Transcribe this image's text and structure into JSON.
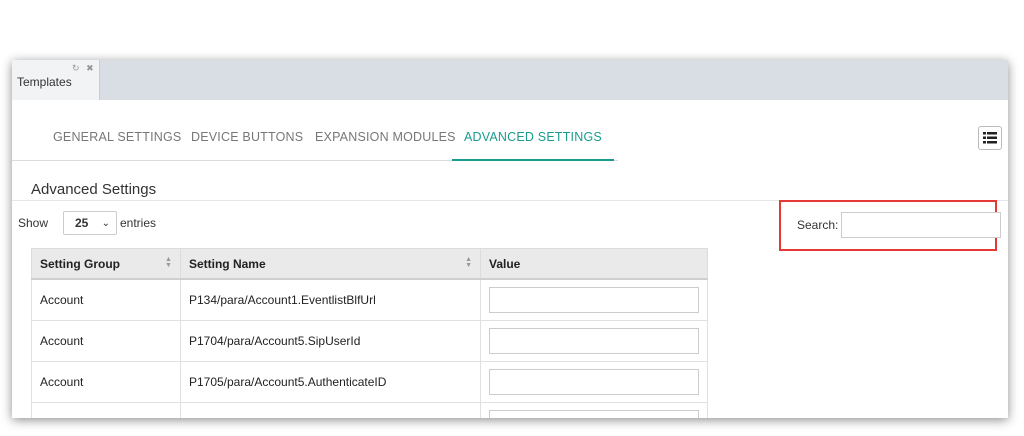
{
  "window": {
    "tab": {
      "label": "Templates",
      "refresh_icon": "↻",
      "close_icon": "✖"
    }
  },
  "nav_tabs": [
    {
      "label": "GENERAL SETTINGS",
      "active": false
    },
    {
      "label": "DEVICE BUTTONS",
      "active": false
    },
    {
      "label": "EXPANSION MODULES",
      "active": false
    },
    {
      "label": "ADVANCED SETTINGS",
      "active": true
    }
  ],
  "menu_icon": "list-menu-icon",
  "section": {
    "title": "Advanced Settings"
  },
  "length_menu": {
    "show_label": "Show",
    "value": "25",
    "entries_label": "entries"
  },
  "search": {
    "label": "Search:",
    "value": ""
  },
  "table": {
    "headers": {
      "group": "Setting Group",
      "name": "Setting Name",
      "value": "Value"
    },
    "rows": [
      {
        "group": "Account",
        "name": "P134/para/Account1.EventlistBlfUrl",
        "value": ""
      },
      {
        "group": "Account",
        "name": "P1704/para/Account5.SipUserId",
        "value": ""
      },
      {
        "group": "Account",
        "name": "P1705/para/Account5.AuthenticateID",
        "value": ""
      },
      {
        "group": "",
        "name": "",
        "value": ""
      }
    ]
  },
  "colors": {
    "accent": "#1a9c8d",
    "highlight": "#e53935"
  }
}
